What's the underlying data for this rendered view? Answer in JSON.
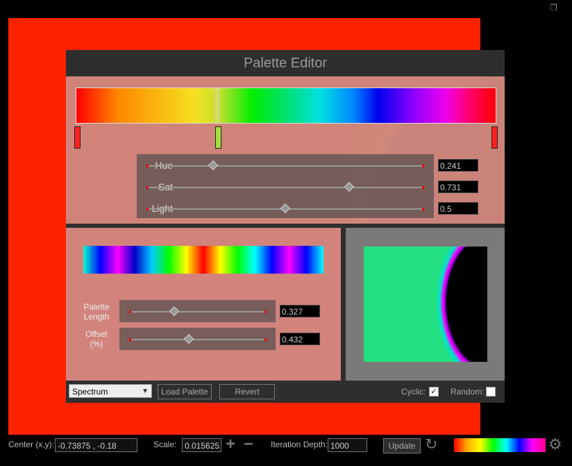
{
  "editor": {
    "title": "Palette Editor",
    "hsl": {
      "hue": {
        "label": "Hue",
        "value": "0.241",
        "fraction": 0.241
      },
      "sat": {
        "label": "Sat",
        "value": "0.731",
        "fraction": 0.731
      },
      "light": {
        "label": "Light",
        "value": "0.5",
        "fraction": 0.5
      }
    },
    "stops": [
      {
        "color": "#ff2020",
        "selected": false
      },
      {
        "color": "#a0e040",
        "selected": true
      },
      {
        "color": "#ff2020",
        "selected": false
      }
    ],
    "palette": {
      "length": {
        "label_line1": "Palette",
        "label_line2": "Length",
        "value": "0.327",
        "fraction": 0.327
      },
      "offset": {
        "label_line1": "Offset",
        "label_line2": "(%)",
        "value": "0.432",
        "fraction": 0.432
      }
    },
    "bottom": {
      "palette_selected": "Spectrum",
      "load_label": "Load Palette",
      "revert_label": "Revert",
      "cyclic_label": "Cyclic:",
      "cyclic_checked": "✓",
      "random_label": "Random:",
      "random_checked": ""
    }
  },
  "status": {
    "center_label": "Center (x,y):",
    "center_value": "-0.73875 , -0.18",
    "scale_label": "Scale:",
    "scale_value": "0.015625",
    "zoom_in_icon": "+",
    "zoom_out_icon": "−",
    "depth_label": "Iteration Depth:",
    "depth_value": "1000",
    "update_label": "Update",
    "reset_icon": "↻",
    "settings_icon": "⚙"
  },
  "window": {
    "restore_icon": "❐"
  }
}
